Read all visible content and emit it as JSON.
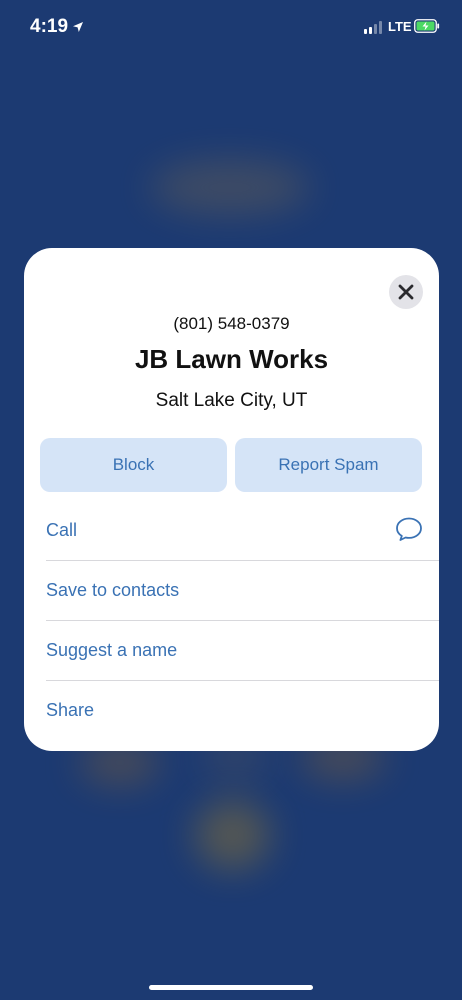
{
  "status_bar": {
    "time": "4:19",
    "network": "LTE",
    "signal_bars_active": 2,
    "battery_state": "charging"
  },
  "card": {
    "phone_number": "(801) 548-0379",
    "name": "JB Lawn Works",
    "location": "Salt Lake City, UT",
    "close_icon": "close-icon",
    "buttons": {
      "block": "Block",
      "report_spam": "Report Spam"
    },
    "menu": [
      {
        "label": "Call",
        "icon": "message-bubble-icon"
      },
      {
        "label": "Save to contacts"
      },
      {
        "label": "Suggest a name"
      },
      {
        "label": "Share"
      }
    ]
  },
  "colors": {
    "background": "#1c3a72",
    "accent": "#3a72b4",
    "button_fill": "#d5e4f7",
    "battery_charging": "#4cd964"
  }
}
